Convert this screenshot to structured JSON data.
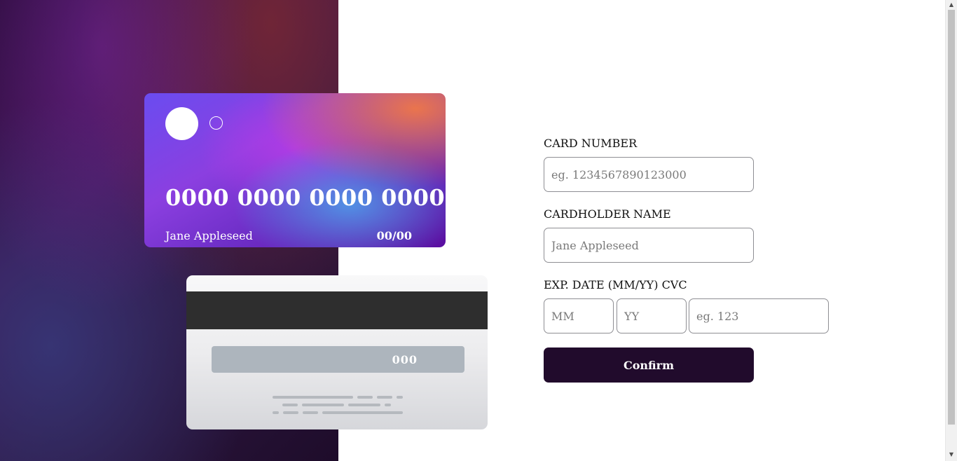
{
  "card": {
    "front": {
      "number": "0000 0000 0000 0000",
      "name": "Jane Appleseed",
      "expiry": "00/00"
    },
    "back": {
      "cvc": "000"
    }
  },
  "form": {
    "card_number_label": "CARD NUMBER",
    "card_number_placeholder": "eg. 1234567890123000",
    "cardholder_label": "CARDHOLDER NAME",
    "cardholder_placeholder": "Jane Appleseed",
    "exp_cvc_label": "EXP. DATE (MM/YY) CVC",
    "month_placeholder": "MM",
    "year_placeholder": "YY",
    "cvc_placeholder": "eg. 123",
    "confirm_label": "Confirm"
  },
  "colors": {
    "confirm_bg": "#210b2c",
    "input_border": "#8e8e93",
    "panel_dark": "#2a0c3a"
  },
  "scrollbar": {
    "up_icon": "triangle-up-icon",
    "down_icon": "triangle-down-icon"
  }
}
